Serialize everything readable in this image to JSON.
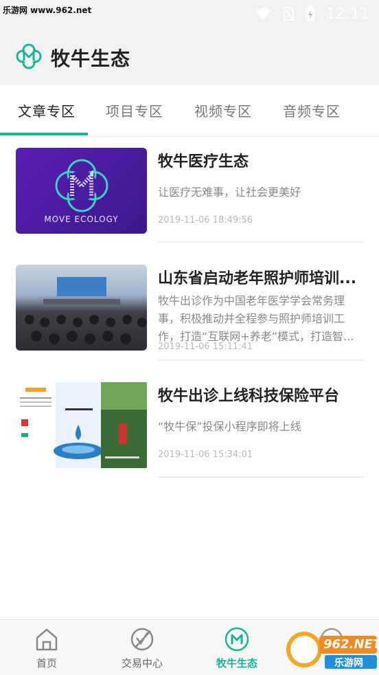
{
  "watermark_top": "乐游网 www.962.net",
  "status": {
    "time": "12:11"
  },
  "header": {
    "title": "牧牛生态"
  },
  "tabs": [
    {
      "label": "文章专区"
    },
    {
      "label": "项目专区"
    },
    {
      "label": "视频专区"
    },
    {
      "label": "音频专区"
    }
  ],
  "articles": [
    {
      "title": "牧牛医疗生态",
      "desc": "让医疗无难事，让社会更美好",
      "date": "2019-11-06 18:49:56",
      "thumb_caption": "MOVE ECOLOGY"
    },
    {
      "title": "山东省启动老年照护师培训...",
      "desc": "牧牛出诊作为中国老年医学学会常务理事，积极推动并全程参与照护师培训工作，打造“互联网+养老”模式，打造智...",
      "date": "2019-11-06 15:11:41"
    },
    {
      "title": "牧牛出诊上线科技保险平台",
      "desc": "“牧牛保”投保小程序即将上线",
      "date": "2019-11-06 15:34:01"
    }
  ],
  "bottom_nav": [
    {
      "label": "首页",
      "icon": "home-icon"
    },
    {
      "label": "交易中心",
      "icon": "trade-icon"
    },
    {
      "label": "牧牛生态",
      "icon": "ecology-icon"
    },
    {
      "label": "",
      "icon": "profile-icon"
    }
  ],
  "watermark_bottom": {
    "brand": "962.NET",
    "site": "乐游网"
  },
  "colors": {
    "accent": "#1ab394",
    "header_bg": "#f2f2f2",
    "thumb_purple": "#4b1ea8"
  }
}
